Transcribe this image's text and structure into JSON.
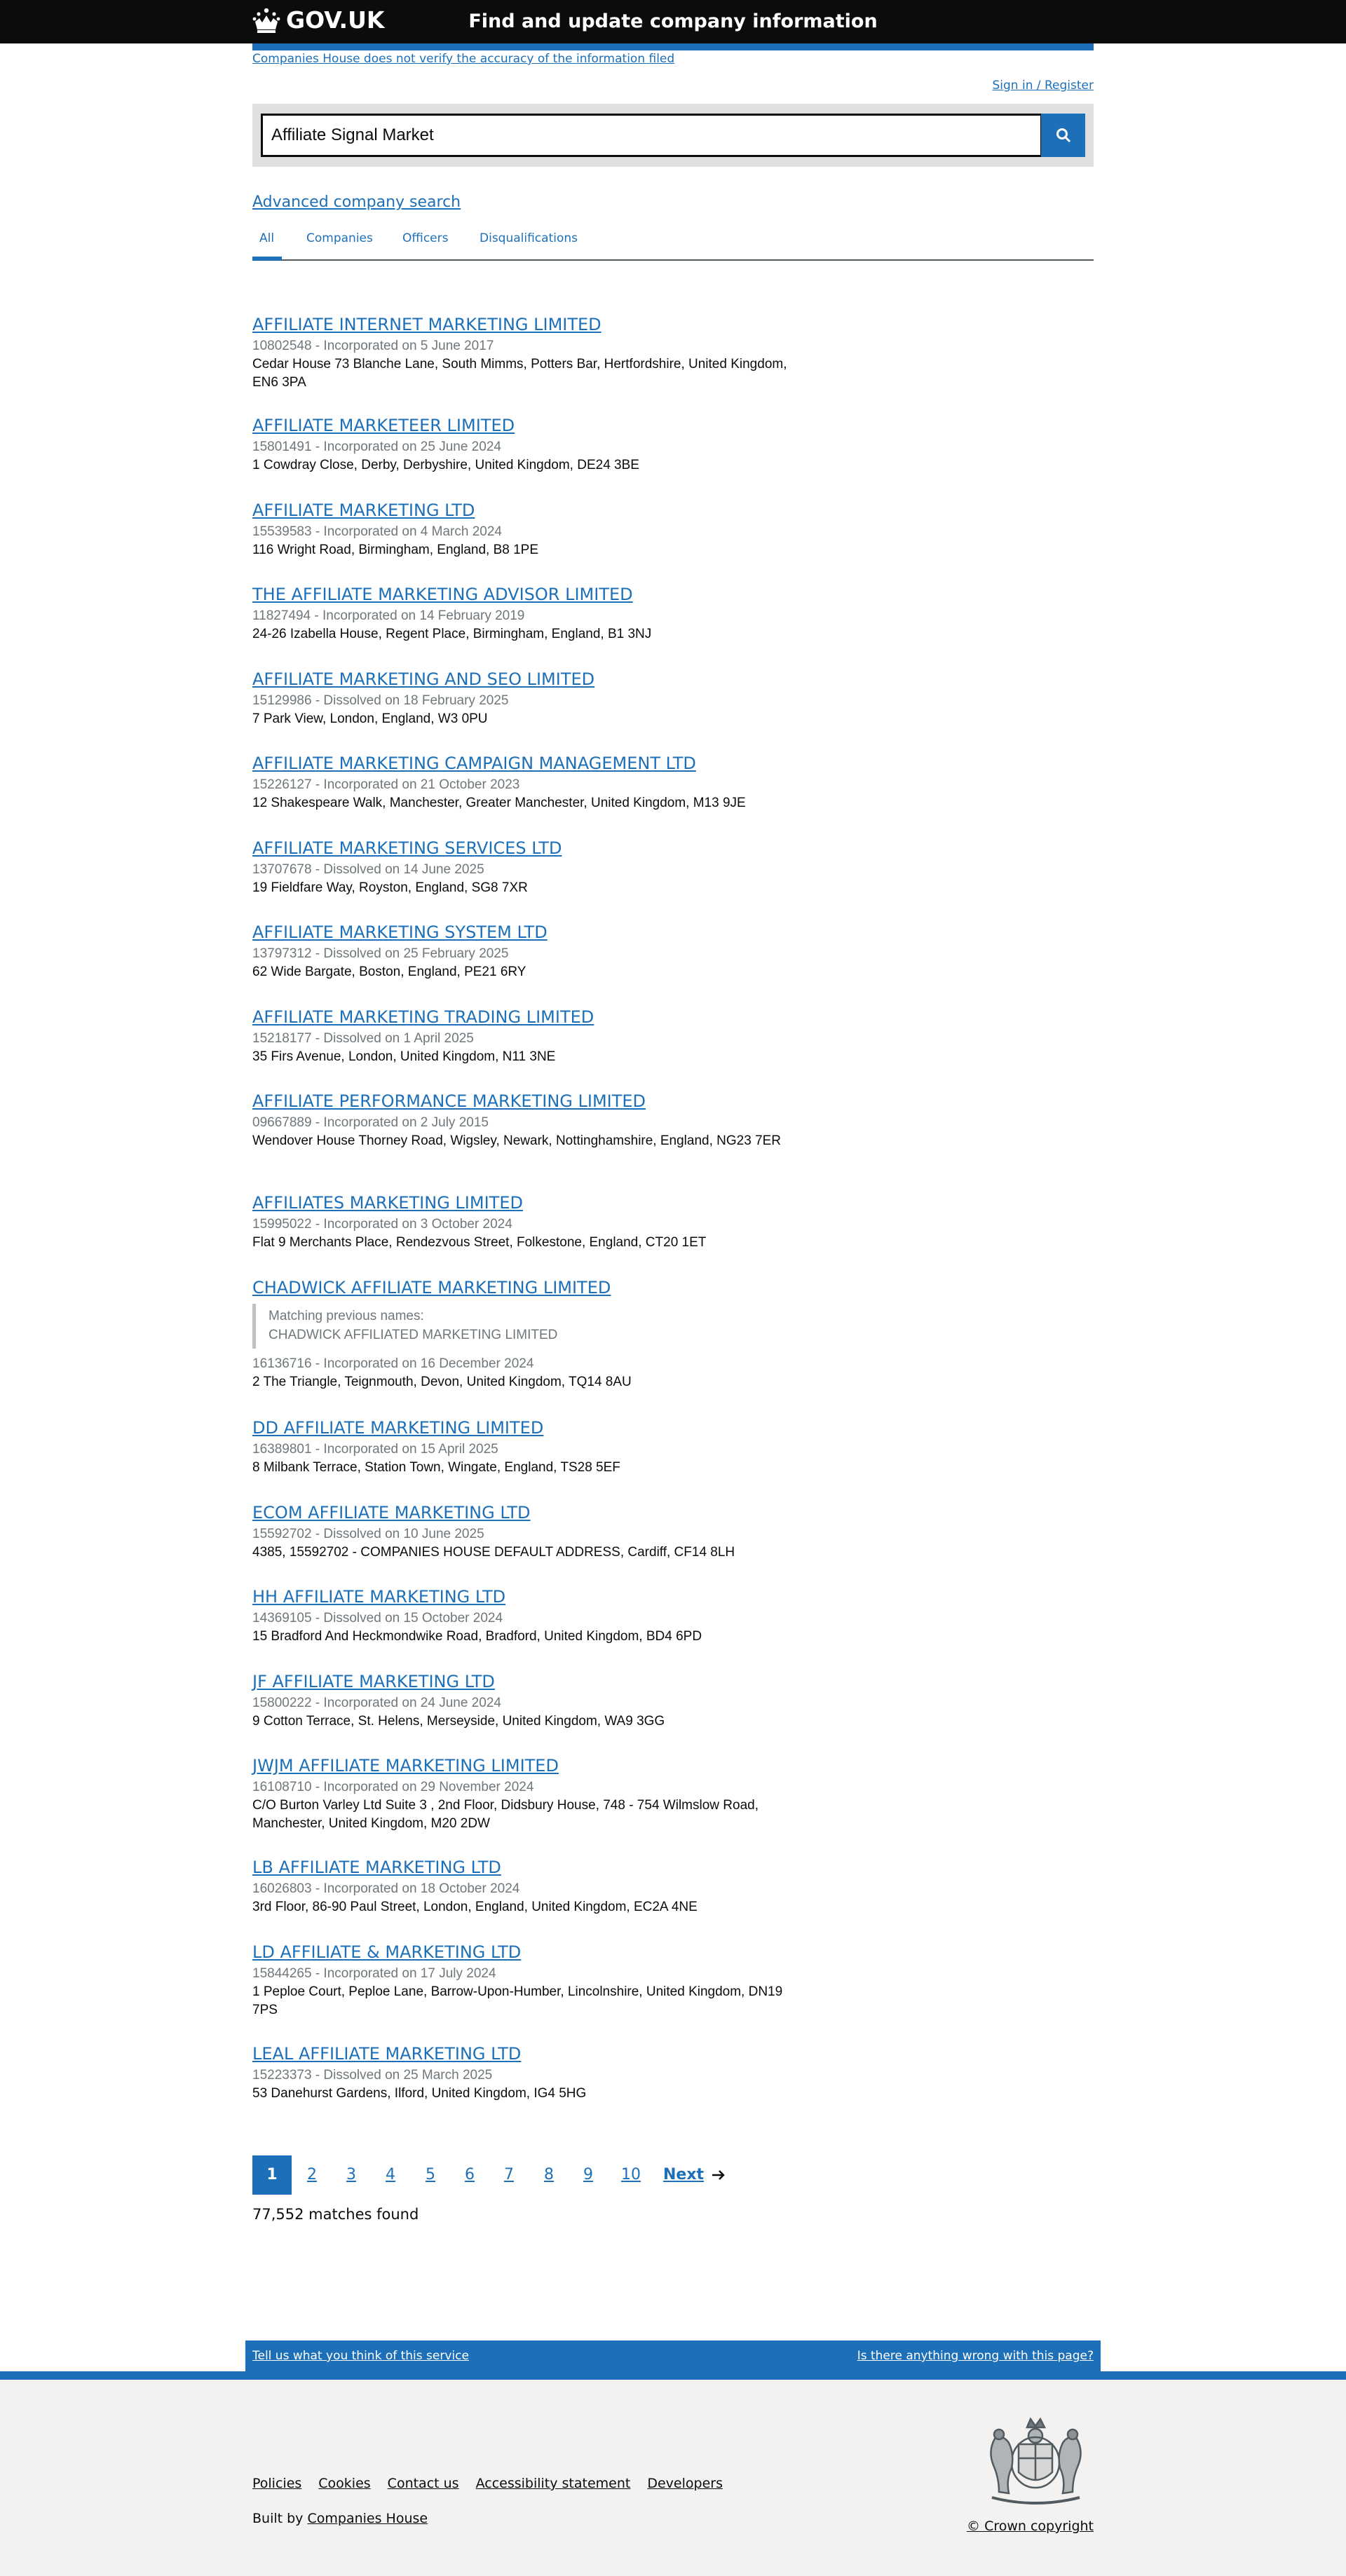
{
  "header": {
    "logo_text": "GOV.UK",
    "service_name": "Find and update company information"
  },
  "disclaimer": "Companies House does not verify the accuracy of the information filed",
  "signin_label": "Sign in / Register",
  "search": {
    "value": "Affiliate Signal Market"
  },
  "advanced_search_label": "Advanced company search",
  "tabs": [
    "All",
    "Companies",
    "Officers",
    "Disqualifications"
  ],
  "results": [
    {
      "name": "AFFILIATE INTERNET MARKETING LIMITED",
      "meta": "10802548 - Incorporated on 5 June 2017",
      "address": "Cedar House 73 Blanche Lane, South Mimms, Potters Bar, Hertfordshire, United Kingdom, EN6 3PA"
    },
    {
      "name": "AFFILIATE MARKETEER LIMITED",
      "meta": "15801491 - Incorporated on 25 June 2024",
      "address": "1 Cowdray Close, Derby, Derbyshire, United Kingdom, DE24 3BE"
    },
    {
      "name": "AFFILIATE MARKETING LTD",
      "meta": "15539583 - Incorporated on 4 March 2024",
      "address": "116 Wright Road, Birmingham, England, B8 1PE"
    },
    {
      "name": "THE AFFILIATE MARKETING ADVISOR LIMITED",
      "meta": "11827494 - Incorporated on 14 February 2019",
      "address": "24-26 Izabella House, Regent Place, Birmingham, England, B1 3NJ"
    },
    {
      "name": "AFFILIATE MARKETING AND SEO LIMITED",
      "meta": "15129986 - Dissolved on 18 February 2025",
      "address": "7 Park View, London, England, W3 0PU"
    },
    {
      "name": "AFFILIATE MARKETING CAMPAIGN MANAGEMENT LTD",
      "meta": "15226127 - Incorporated on 21 October 2023",
      "address": "12 Shakespeare Walk, Manchester, Greater Manchester, United Kingdom, M13 9JE"
    },
    {
      "name": "AFFILIATE MARKETING SERVICES LTD",
      "meta": "13707678 - Dissolved on 14 June 2025",
      "address": "19 Fieldfare Way, Royston, England, SG8 7XR"
    },
    {
      "name": "AFFILIATE MARKETING SYSTEM LTD",
      "meta": "13797312 - Dissolved on 25 February 2025",
      "address": "62 Wide Bargate, Boston, England, PE21 6RY"
    },
    {
      "name": "AFFILIATE MARKETING TRADING LIMITED",
      "meta": "15218177 - Dissolved on 1 April 2025",
      "address": "35 Firs Avenue, London, United Kingdom, N11 3NE"
    },
    {
      "name": "AFFILIATE PERFORMANCE MARKETING LIMITED",
      "meta": "09667889 - Incorporated on 2 July 2015",
      "address": "Wendover House Thorney Road, Wigsley, Newark, Nottinghamshire, England, NG23 7ER"
    },
    {
      "name": "AFFILIATES MARKETING LIMITED",
      "meta": "15995022 - Incorporated on 3 October 2024",
      "address": "Flat 9 Merchants Place, Rendezvous Street, Folkestone, England, CT20 1ET"
    },
    {
      "name": "CHADWICK AFFILIATE MARKETING LIMITED",
      "previous_names_label": "Matching previous names:",
      "previous_name": "CHADWICK AFFILIATED MARKETING LIMITED",
      "meta": "16136716 - Incorporated on 16 December 2024",
      "address": "2 The Triangle, Teignmouth, Devon, United Kingdom, TQ14 8AU"
    },
    {
      "name": "DD AFFILIATE MARKETING LIMITED",
      "meta": "16389801 - Incorporated on 15 April 2025",
      "address": "8 Milbank Terrace, Station Town, Wingate, England, TS28 5EF"
    },
    {
      "name": "ECOM AFFILIATE MARKETING LTD",
      "meta": "15592702 - Dissolved on 10 June 2025",
      "address": "4385, 15592702 - COMPANIES HOUSE DEFAULT ADDRESS, Cardiff, CF14 8LH"
    },
    {
      "name": "HH AFFILIATE MARKETING LTD",
      "meta": "14369105 - Dissolved on 15 October 2024",
      "address": "15 Bradford And Heckmondwike Road, Bradford, United Kingdom, BD4 6PD"
    },
    {
      "name": "JF AFFILIATE MARKETING LTD",
      "meta": "15800222 - Incorporated on 24 June 2024",
      "address": "9 Cotton Terrace, St. Helens, Merseyside, United Kingdom, WA9 3GG"
    },
    {
      "name": "JWJM AFFILIATE MARKETING LIMITED",
      "meta": "16108710 - Incorporated on 29 November 2024",
      "address": "C/O Burton Varley Ltd Suite 3 , 2nd Floor, Didsbury House, 748 - 754 Wilmslow Road, Manchester, United Kingdom, M20 2DW"
    },
    {
      "name": "LB AFFILIATE MARKETING LTD",
      "meta": "16026803 - Incorporated on 18 October 2024",
      "address": "3rd Floor, 86-90 Paul Street, London, England, United Kingdom, EC2A 4NE"
    },
    {
      "name": "LD AFFILIATE & MARKETING LTD",
      "meta": "15844265 - Incorporated on 17 July 2024",
      "address": "1 Peploe Court, Peploe Lane, Barrow-Upon-Humber, Lincolnshire, United Kingdom, DN19 7PS"
    },
    {
      "name": "LEAL AFFILIATE MARKETING LTD",
      "meta": "15223373 - Dissolved on 25 March 2025",
      "address": "53 Danehurst Gardens, Ilford, United Kingdom, IG4 5HG"
    }
  ],
  "pagination": {
    "pages": [
      "1",
      "2",
      "3",
      "4",
      "5",
      "6",
      "7",
      "8",
      "9",
      "10"
    ],
    "current": "1",
    "next_label": "Next",
    "matches": "77,552 matches found"
  },
  "feedback": {
    "left_link": "Tell us what you think of this service",
    "right_link": "Is there anything wrong with this page?"
  },
  "footer": {
    "links": [
      "Policies",
      "Cookies",
      "Contact us",
      "Accessibility statement",
      "Developers"
    ],
    "built_by_prefix": "Built by",
    "built_by_link": "Companies House",
    "copyright": "© Crown copyright"
  },
  "colors": {
    "link": "#1d70b8",
    "header_bg": "#0b0c0c",
    "footer_bg": "#f3f2f1",
    "meta_text": "#6f777b"
  }
}
